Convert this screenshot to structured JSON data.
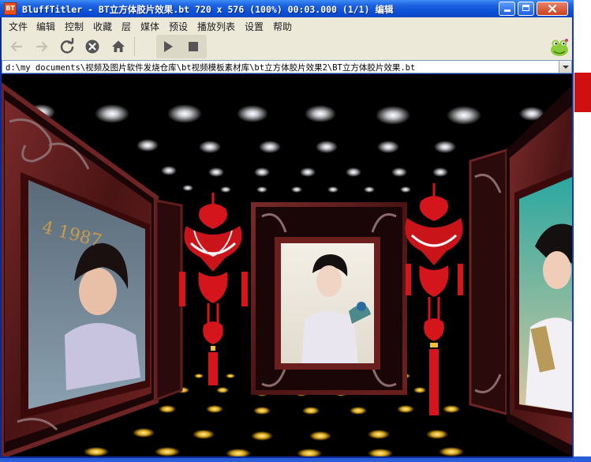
{
  "window": {
    "title": "BluffTitler - BT立方体胶片效果.bt 720 x 576 (100%) 00:03.000 (1/1) 编辑",
    "app_icon_label": "BT"
  },
  "menu": {
    "items": [
      "文件",
      "编辑",
      "控制",
      "收藏",
      "层",
      "媒体",
      "预设",
      "播放列表",
      "设置",
      "帮助"
    ]
  },
  "toolbar": {
    "buttons": [
      {
        "name": "back-arrow-icon",
        "enabled": false
      },
      {
        "name": "forward-arrow-icon",
        "enabled": false
      },
      {
        "name": "refresh-icon",
        "enabled": true
      },
      {
        "name": "stop-circle-icon",
        "enabled": true
      },
      {
        "name": "home-icon",
        "enabled": true
      },
      {
        "name": "play-icon",
        "enabled": true
      },
      {
        "name": "stop-square-icon",
        "enabled": true
      }
    ]
  },
  "address": {
    "path": "d:\\my documents\\视频及图片软件发烧仓库\\bt视频模板素材库\\bt立方体胶片效果2\\BT立方体胶片效果.bt"
  },
  "preview": {
    "scene": "3d-photo-gallery-room",
    "left_frame_text": "4 1987"
  },
  "colors": {
    "titlebar": "#0a4fd6",
    "menubar": "#ece9d8",
    "frame_wood": "#5a1a1a",
    "knot_red": "#d4161c",
    "floor_gold": "#f2c030"
  }
}
